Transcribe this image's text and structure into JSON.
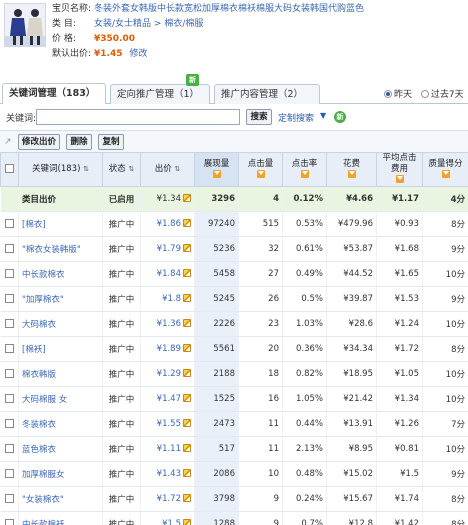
{
  "product": {
    "name_label": "宝贝名称:",
    "name": "冬装外套女韩版中长款宽松加厚棉衣棉袄棉服大码女装韩国代购蓝色",
    "category_label": "类    目:",
    "category_part1": "女装/女士精品",
    "category_sep": " > ",
    "category_part2": "棉衣/棉服",
    "price_label": "价    格:",
    "price": "¥350.00",
    "default_bid_label": "默认出价:",
    "default_bid": "¥1.45",
    "edit_link": "修改"
  },
  "tabs": [
    {
      "label": "关键词管理（183）",
      "active": true
    },
    {
      "label": "定向推广管理（1）",
      "active": false,
      "badge": "新"
    },
    {
      "label": "推广内容管理（2）",
      "active": false
    }
  ],
  "date_filter": {
    "opt1": "昨天",
    "opt2": "过去7天"
  },
  "search": {
    "label": "关键词:",
    "placeholder": "",
    "search_button": "搜索",
    "custom_search": "定制搜索",
    "custom_arrow": "▼",
    "badge": "新"
  },
  "actions": {
    "modify_bid": "修改出价",
    "delete": "删除",
    "copy": "复制"
  },
  "table": {
    "headers": {
      "keyword": "关键词(183)",
      "status": "状态",
      "bid": "出价",
      "impressions": "展现量",
      "clicks": "点击量",
      "ctr": "点击率",
      "cost": "花费",
      "avg_cpc": "平均点击费用",
      "quality": "质量得分"
    },
    "total": {
      "keyword": "类目出价",
      "status": "已启用",
      "bid": "¥1.34",
      "impressions": "3296",
      "clicks": "4",
      "ctr": "0.12%",
      "cost": "¥4.66",
      "avg_cpc": "¥1.17",
      "quality": "4分"
    },
    "rows": [
      {
        "keyword": "[棉衣]",
        "status": "推广中",
        "bid": "¥1.86",
        "impressions": "97240",
        "clicks": "515",
        "ctr": "0.53%",
        "cost": "¥479.96",
        "avg_cpc": "¥0.93",
        "quality": "8分"
      },
      {
        "keyword": "\"棉衣女装韩版\"",
        "status": "推广中",
        "bid": "¥1.79",
        "impressions": "5236",
        "clicks": "32",
        "ctr": "0.61%",
        "cost": "¥53.87",
        "avg_cpc": "¥1.68",
        "quality": "9分"
      },
      {
        "keyword": "中长款棉衣",
        "status": "推广中",
        "bid": "¥1.84",
        "impressions": "5458",
        "clicks": "27",
        "ctr": "0.49%",
        "cost": "¥44.52",
        "avg_cpc": "¥1.65",
        "quality": "10分"
      },
      {
        "keyword": "\"加厚棉衣\"",
        "status": "推广中",
        "bid": "¥1.8",
        "impressions": "5245",
        "clicks": "26",
        "ctr": "0.5%",
        "cost": "¥39.87",
        "avg_cpc": "¥1.53",
        "quality": "9分"
      },
      {
        "keyword": "大码棉衣",
        "status": "推广中",
        "bid": "¥1.36",
        "impressions": "2226",
        "clicks": "23",
        "ctr": "1.03%",
        "cost": "¥28.6",
        "avg_cpc": "¥1.24",
        "quality": "10分"
      },
      {
        "keyword": "[棉袄]",
        "status": "推广中",
        "bid": "¥1.89",
        "impressions": "5561",
        "clicks": "20",
        "ctr": "0.36%",
        "cost": "¥34.34",
        "avg_cpc": "¥1.72",
        "quality": "8分"
      },
      {
        "keyword": "棉衣韩版",
        "status": "推广中",
        "bid": "¥1.29",
        "impressions": "2188",
        "clicks": "18",
        "ctr": "0.82%",
        "cost": "¥18.95",
        "avg_cpc": "¥1.05",
        "quality": "10分"
      },
      {
        "keyword": "大码棉服 女",
        "status": "推广中",
        "bid": "¥1.47",
        "impressions": "1525",
        "clicks": "16",
        "ctr": "1.05%",
        "cost": "¥21.42",
        "avg_cpc": "¥1.34",
        "quality": "10分"
      },
      {
        "keyword": "冬装棉衣",
        "status": "推广中",
        "bid": "¥1.55",
        "impressions": "2473",
        "clicks": "11",
        "ctr": "0.44%",
        "cost": "¥13.91",
        "avg_cpc": "¥1.26",
        "quality": "7分"
      },
      {
        "keyword": "蓝色棉衣",
        "status": "推广中",
        "bid": "¥1.11",
        "impressions": "517",
        "clicks": "11",
        "ctr": "2.13%",
        "cost": "¥8.95",
        "avg_cpc": "¥0.81",
        "quality": "10分"
      },
      {
        "keyword": "加厚棉服女",
        "status": "推广中",
        "bid": "¥1.43",
        "impressions": "2086",
        "clicks": "10",
        "ctr": "0.48%",
        "cost": "¥15.02",
        "avg_cpc": "¥1.5",
        "quality": "9分"
      },
      {
        "keyword": "\"女装棉衣\"",
        "status": "推广中",
        "bid": "¥1.72",
        "impressions": "3798",
        "clicks": "9",
        "ctr": "0.24%",
        "cost": "¥15.67",
        "avg_cpc": "¥1.74",
        "quality": "8分"
      },
      {
        "keyword": "中长款棉袄",
        "status": "推广中",
        "bid": "¥1.5",
        "impressions": "1288",
        "clicks": "9",
        "ctr": "0.7%",
        "cost": "¥12.8",
        "avg_cpc": "¥1.42",
        "quality": "8分"
      }
    ]
  }
}
